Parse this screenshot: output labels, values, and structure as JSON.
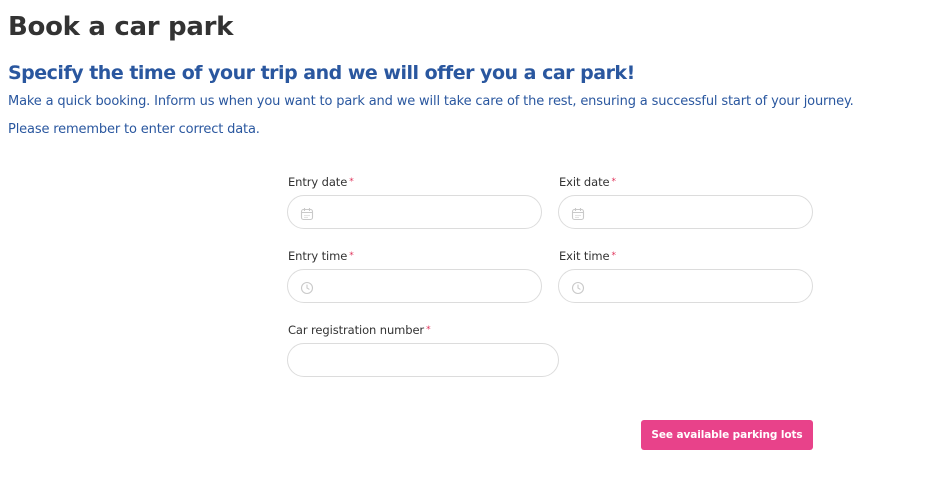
{
  "page": {
    "title": "Book a car park",
    "subtitle": "Specify the time of your trip and we will offer you a car park!",
    "intro_line1": "Make a quick booking. Inform us when you want to park and we will take care of the rest, ensuring a successful start of your journey.",
    "intro_line2": "Please remember to enter correct data."
  },
  "form": {
    "required_marker": "*",
    "entry_date": {
      "label": "Entry date",
      "value": "",
      "icon": "calendar-icon"
    },
    "exit_date": {
      "label": "Exit date",
      "value": "",
      "icon": "calendar-icon"
    },
    "entry_time": {
      "label": "Entry time",
      "value": "",
      "icon": "clock-icon"
    },
    "exit_time": {
      "label": "Exit time",
      "value": "",
      "icon": "clock-icon"
    },
    "registration": {
      "label": "Car registration number",
      "value": ""
    },
    "submit_label": "See available parking lots"
  },
  "colors": {
    "heading": "#333333",
    "accent_blue": "#2a579f",
    "button_pink": "#e8428a",
    "required_red": "#e0335a",
    "field_border": "#dcdcdc"
  }
}
